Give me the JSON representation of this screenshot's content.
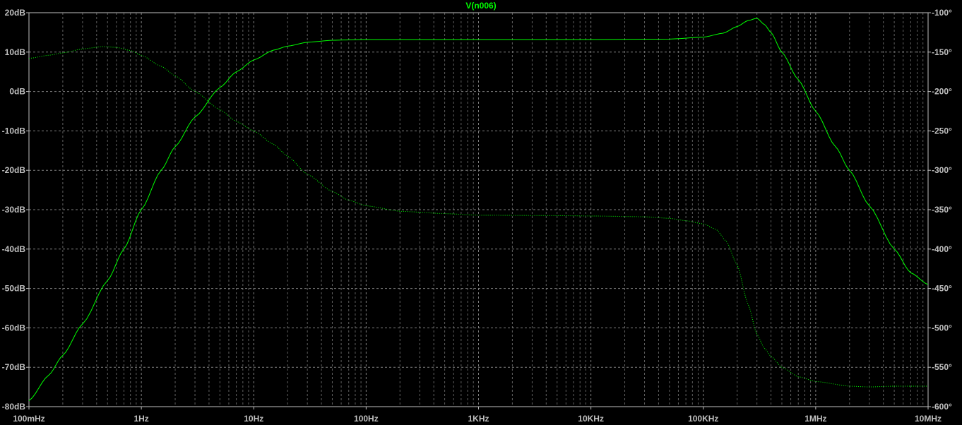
{
  "chart_data": {
    "type": "line",
    "title": "V(n006)",
    "title_color": "#00ff00",
    "background": "#000000",
    "axis_color": "#c0c0c0",
    "grid": true,
    "grid_color": "#808080",
    "trace_color": "#00ff00",
    "x_scale": "log",
    "xlim_hz": [
      0.1,
      10000000
    ],
    "x_tick_values_hz": [
      0.1,
      1,
      10,
      100,
      1000,
      10000,
      100000,
      1000000,
      10000000
    ],
    "x_tick_labels": [
      "100mHz",
      "1Hz",
      "10Hz",
      "100Hz",
      "1KHz",
      "10KHz",
      "100KHz",
      "1MHz",
      "10MHz"
    ],
    "y_left_lim_db": [
      -80,
      20
    ],
    "y_left_tick_values": [
      20,
      10,
      0,
      -10,
      -20,
      -30,
      -40,
      -50,
      -60,
      -70,
      -80
    ],
    "y_left_tick_labels": [
      "20dB",
      "10dB",
      "0dB",
      "-10dB",
      "-20dB",
      "-30dB",
      "-40dB",
      "-50dB",
      "-60dB",
      "-70dB",
      "-80dB"
    ],
    "y_right_lim_deg": [
      -600,
      -100
    ],
    "y_right_tick_values": [
      -100,
      -150,
      -200,
      -250,
      -300,
      -350,
      -400,
      -450,
      -500,
      -550,
      -600
    ],
    "y_right_tick_labels": [
      "-100°",
      "-150°",
      "-200°",
      "-250°",
      "-300°",
      "-350°",
      "-400°",
      "-450°",
      "-500°",
      "-550°",
      "-600°"
    ],
    "series": [
      {
        "style": "solid",
        "axis": "left",
        "unit": "dB",
        "x": [
          0.1,
          0.15,
          0.2,
          0.3,
          0.5,
          0.7,
          1,
          1.5,
          2,
          3,
          5,
          7,
          10,
          15,
          20,
          30,
          50,
          70,
          100,
          200,
          500,
          1000,
          10000,
          50000,
          100000,
          150000,
          200000,
          250000,
          300000,
          350000,
          400000,
          500000,
          700000,
          1000000,
          1500000,
          2000000,
          3000000,
          5000000,
          7000000,
          10000000
        ],
        "values": [
          -78.5,
          -72,
          -67,
          -59,
          -48,
          -40,
          -30,
          -20,
          -14,
          -6.5,
          1,
          5,
          8,
          10.5,
          11.5,
          12.5,
          13,
          13.1,
          13.2,
          13.2,
          13.2,
          13.2,
          13.2,
          13.3,
          13.8,
          14.8,
          16.5,
          18,
          18.6,
          17,
          15,
          10,
          3,
          -5,
          -14,
          -20,
          -29,
          -40,
          -46,
          -49
        ]
      },
      {
        "style": "dotted",
        "axis": "right",
        "unit": "deg",
        "x": [
          0.1,
          0.15,
          0.2,
          0.3,
          0.45,
          0.6,
          0.8,
          1,
          1.5,
          2,
          3,
          5,
          7,
          10,
          15,
          20,
          30,
          50,
          70,
          100,
          200,
          500,
          1000,
          5000,
          10000,
          30000,
          50000,
          70000,
          100000,
          130000,
          160000,
          200000,
          250000,
          300000,
          350000,
          400000,
          500000,
          700000,
          1000000,
          2000000,
          3000000,
          5000000,
          10000000
        ],
        "values": [
          -158,
          -154,
          -151,
          -146,
          -143,
          -144,
          -148,
          -154,
          -168,
          -180,
          -200,
          -223,
          -238,
          -250,
          -267,
          -282,
          -305,
          -327,
          -338,
          -345,
          -352,
          -355,
          -357,
          -357.5,
          -358,
          -359,
          -361,
          -364,
          -368,
          -375,
          -390,
          -420,
          -470,
          -508,
          -526,
          -536,
          -550,
          -562,
          -568,
          -574,
          -575,
          -574,
          -574
        ]
      }
    ]
  }
}
